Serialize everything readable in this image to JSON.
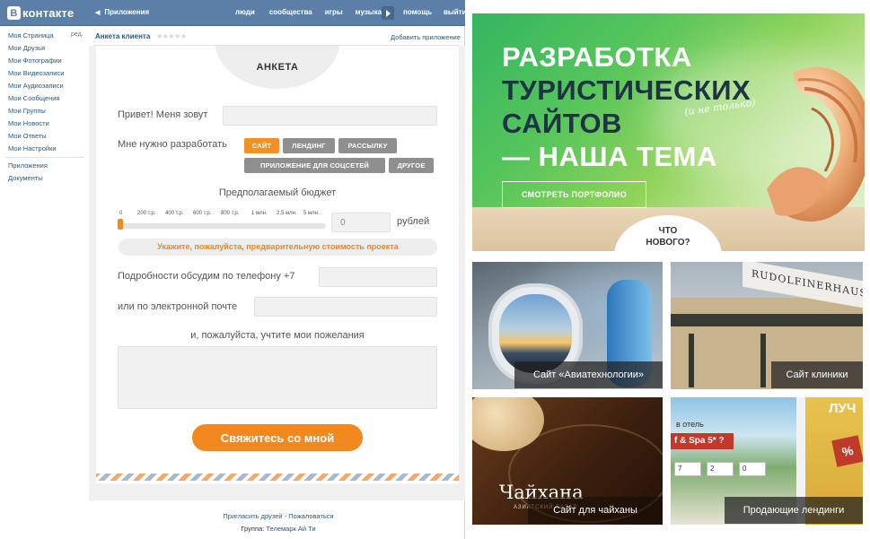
{
  "vk": {
    "logo_mark": "В",
    "logo_text": "контакте",
    "back_label": "Приложения",
    "nav": [
      "люди",
      "сообщества",
      "игры",
      "музыка",
      "помощь",
      "выйти"
    ],
    "sidebar": {
      "edit_label": "ред.",
      "items": [
        "Моя Страница",
        "Мои Друзья",
        "Мои Фотографии",
        "Мои Видеозаписи",
        "Мои Аудиозаписи",
        "Мои Сообщения",
        "Мои Группы",
        "Мои Новости",
        "Мои Ответы",
        "Мои Настройки"
      ],
      "extra_items": [
        "Приложения",
        "Документы"
      ]
    },
    "app_title": "Анкета клиента",
    "stars": "★★★★★",
    "add_app": "Добавить приложение",
    "footer": {
      "invite": "Пригласить друзей",
      "separator": " - ",
      "complain": "Пожаловаться",
      "group_prefix": "Группа:",
      "group_name": "Телемарк Ай Ти"
    }
  },
  "form": {
    "title": "АНКЕТА",
    "greeting_label": "Привет! Меня зовут",
    "name_value": "",
    "develop_label": "Мне нужно разработать",
    "options": [
      {
        "label": "САЙТ",
        "selected": true
      },
      {
        "label": "ЛЕНДИНГ",
        "selected": false
      },
      {
        "label": "РАССЫЛКУ",
        "selected": false
      },
      {
        "label": "ПРИЛОЖЕНИЕ ДЛЯ СОЦСЕТЕЙ",
        "selected": false
      },
      {
        "label": "ДРУГОЕ",
        "selected": false
      }
    ],
    "budget_label": "Предполагаемый бюджет",
    "budget_ticks": [
      "0",
      "200 т.р.",
      "400 т.р.",
      "600 т.р.",
      "800 т.р.",
      "1 млн.",
      "2,5 млн.",
      "5 млн."
    ],
    "budget_slider_fraction": 0,
    "budget_value": "0",
    "currency": "рублей",
    "budget_hint": "Укажите, пожалуйста, предварительную стоимость проекта",
    "phone_label": "Подробности обсудим по телефону +7",
    "phone_value": "",
    "email_label": "или по электронной почте",
    "email_value": "",
    "wishes_label": "и, пожалуйста, учтите мои пожелания",
    "wishes_value": "",
    "submit_label": "Свяжитесь со мной"
  },
  "portfolio": {
    "headline": [
      "РАЗРАБОТКА",
      "ТУРИСТИЧЕСКИХ",
      "САЙТОВ",
      "— НАША ТЕМА"
    ],
    "headline_note": "(и не только)",
    "portfolio_button": "СМОТРЕТЬ ПОРТФОЛИО",
    "whats_new": [
      "ЧТО",
      "НОВОГО?"
    ],
    "tiles": [
      {
        "caption": "Сайт «Авиатехнологии»"
      },
      {
        "caption": "Сайт клиники",
        "sign": "RUDOLFINERHAUS"
      },
      {
        "caption": "Сайт для чайханы",
        "logo": "Чайхана",
        "logo_sub": "АЗИАТСКИЙ БАЗАР"
      },
      {
        "caption": "Продающие лендинги",
        "banner_top": "в отель",
        "banner_title": "f & Spa 5* ?",
        "corner_text": "ЛУЧ",
        "corner_badge": "%",
        "selects": [
          "7",
          "2",
          "0"
        ]
      }
    ]
  },
  "colors": {
    "vk_header": "#5b7fa6",
    "vk_link": "#2b587a",
    "accent_orange": "#f29128",
    "option_grey": "#8f8f8f",
    "hero_green": "#34b560"
  }
}
